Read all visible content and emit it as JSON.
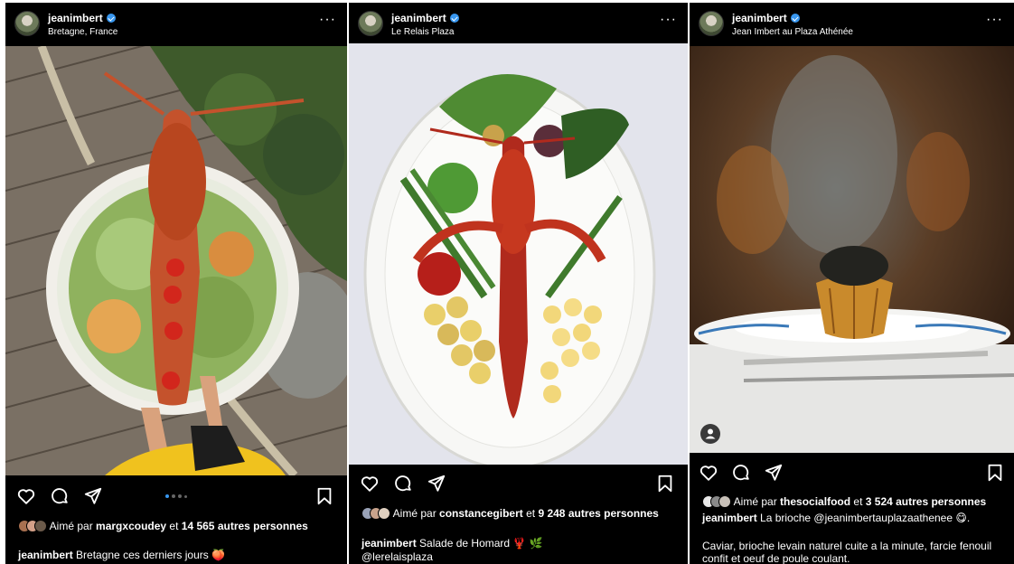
{
  "posts": [
    {
      "username": "jeanimbert",
      "location": "Bretagne, France",
      "more": "···",
      "likes_prefix": "Aimé par",
      "likes_user": "margxcoudey",
      "likes_mid": "et",
      "likes_count": "14 565 autres personnes",
      "caption_user": "jeanimbert",
      "caption_text": "Bretagne ces derniers jours 🍑",
      "carousel_dots": 4,
      "carousel_active": 0
    },
    {
      "username": "jeanimbert",
      "location": "Le Relais Plaza",
      "more": "···",
      "likes_prefix": "Aimé par",
      "likes_user": "constancegibert",
      "likes_mid": "et",
      "likes_count": "9 248 autres personnes",
      "caption_user": "jeanimbert",
      "caption_text": "Salade de Homard 🦞 🌿",
      "caption_mention": "@lerelaisplaza"
    },
    {
      "username": "jeanimbert",
      "location": "Jean Imbert au Plaza Athénée",
      "more": "···",
      "likes_prefix": "Aimé par",
      "likes_user": "thesocialfood",
      "likes_mid": "et",
      "likes_count": "3 524 autres personnes",
      "caption_user": "jeanimbert",
      "caption_text": "La brioche @jeanimbertauplazaathenee 😋.",
      "caption_more": "Caviar, brioche levain naturel cuite a la minute, farcie fenouil confit et oeuf de poule coulant."
    }
  ],
  "icons": {
    "like": "heart-icon",
    "comment": "comment-icon",
    "share": "share-icon",
    "save": "bookmark-icon",
    "verified": "verified-badge-icon",
    "tagged": "user-tag-icon"
  },
  "colors": {
    "background": "#000000",
    "text": "#ffffff",
    "verified": "#3897f0"
  }
}
